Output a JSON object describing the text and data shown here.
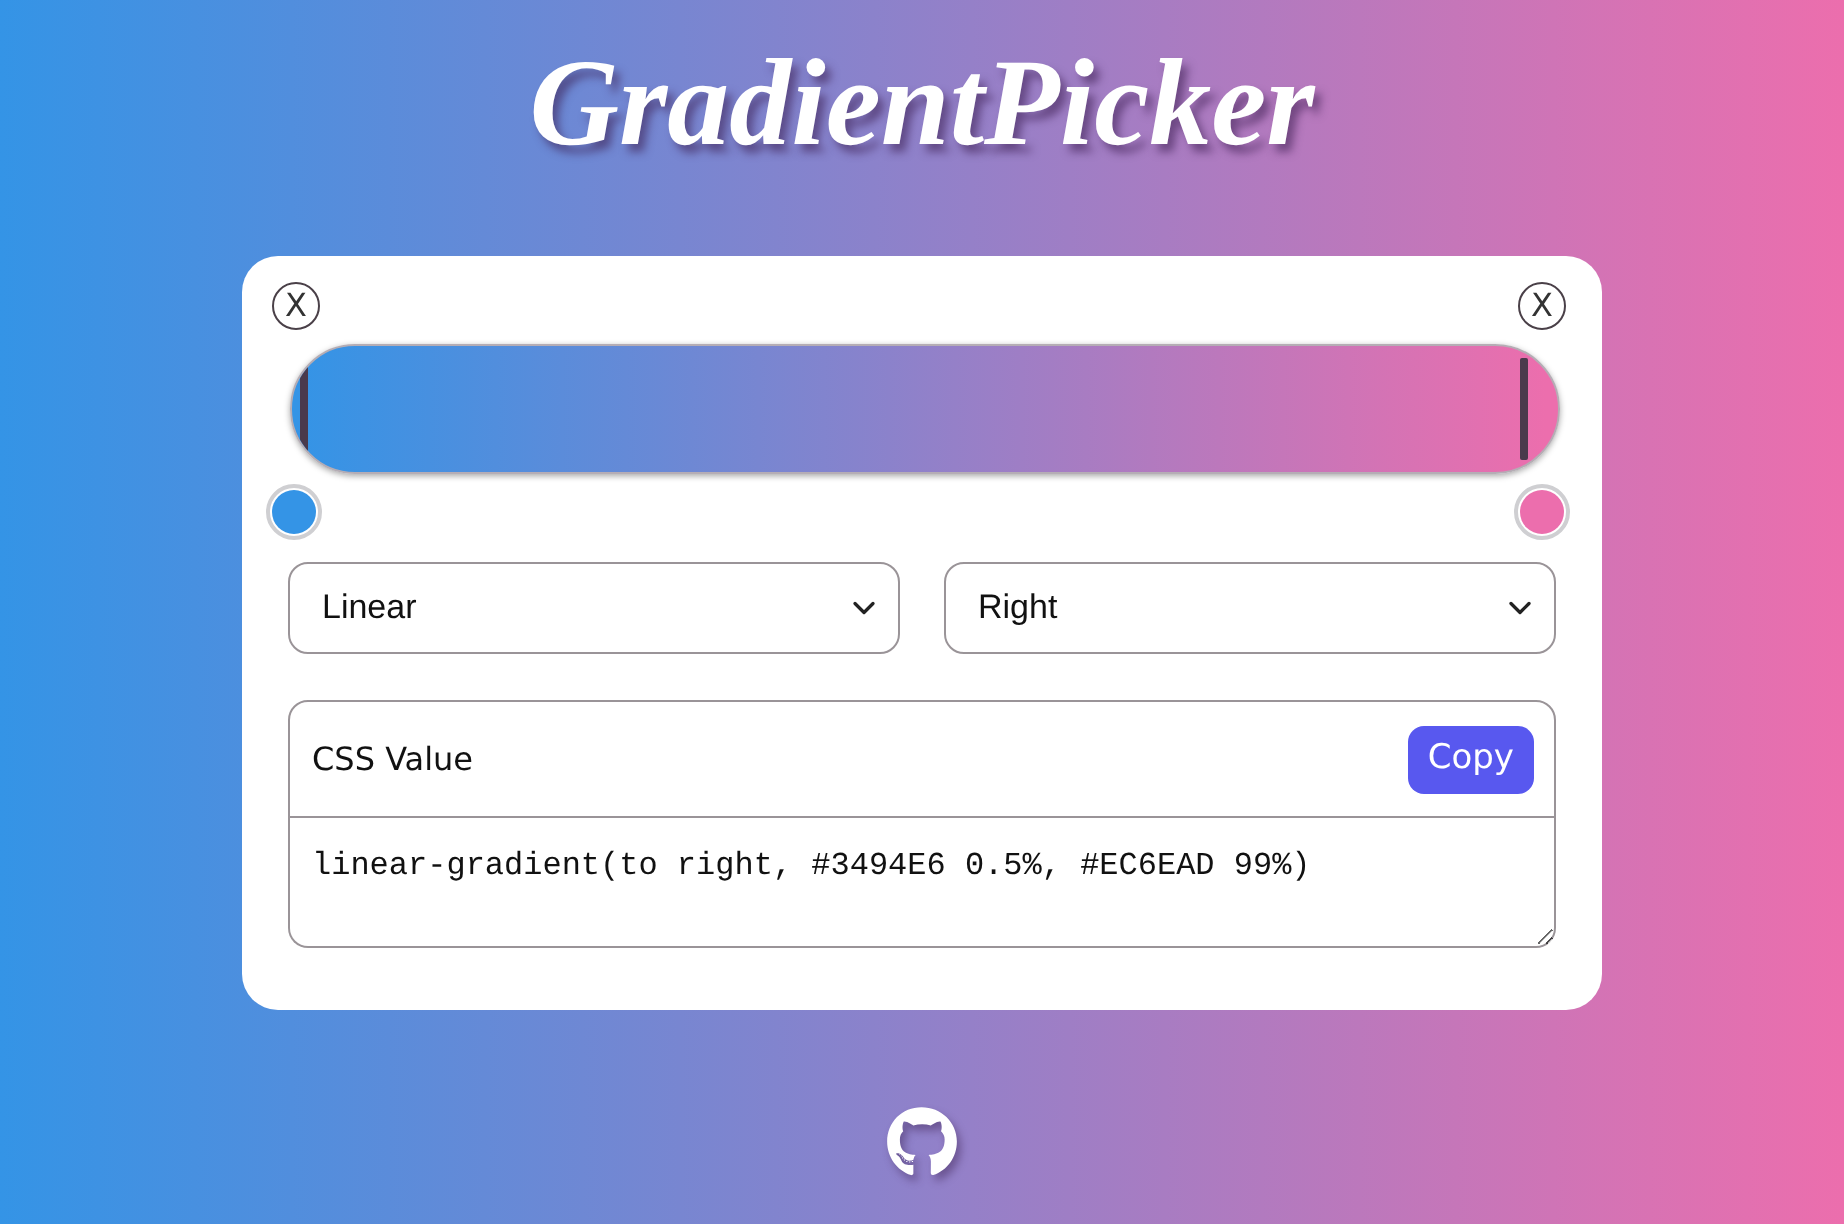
{
  "title": "GradientPicker",
  "stops": [
    {
      "remove_label": "X",
      "color": "#3494e6",
      "level": 0.005
    },
    {
      "remove_label": "X",
      "color": "#ec6ead",
      "level": 0.99
    }
  ],
  "type_select": {
    "value": "Linear"
  },
  "direction_select": {
    "value": "Right"
  },
  "css_panel": {
    "label": "CSS Value",
    "copy_button": "Copy",
    "value": "linear-gradient(to right, #3494E6 0.5%, #EC6EAD 99%)"
  }
}
